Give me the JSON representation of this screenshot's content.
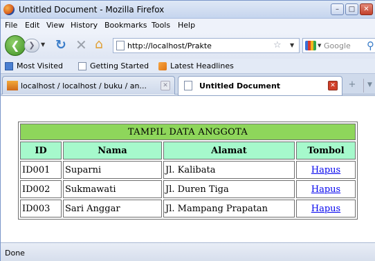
{
  "window": {
    "title": "Untitled Document - Mozilla Firefox",
    "buttons": {
      "minimize": "–",
      "maximize": "□",
      "close": "✕"
    }
  },
  "menu": [
    "File",
    "Edit",
    "View",
    "History",
    "Bookmarks",
    "Tools",
    "Help"
  ],
  "navigation": {
    "url": "http://localhost/Prakte",
    "search_placeholder": "Google"
  },
  "bookmarks": [
    "Most Visited",
    "Getting Started",
    "Latest Headlines"
  ],
  "tabs": [
    {
      "label": "localhost / localhost / buku / an...",
      "active": false,
      "icon": "phpmyadmin-icon"
    },
    {
      "label": "Untitled Document",
      "active": true,
      "icon": "page-icon"
    }
  ],
  "table": {
    "title": "TAMPIL DATA ANGGOTA",
    "headers": [
      "ID",
      "Nama",
      "Alamat",
      "Tombol"
    ],
    "rows": [
      {
        "id": "ID001",
        "nama": "Suparni",
        "alamat": "Jl. Kalibata",
        "tombol": "Hapus"
      },
      {
        "id": "ID002",
        "nama": "Sukmawati",
        "alamat": "Jl. Duren Tiga",
        "tombol": "Hapus"
      },
      {
        "id": "ID003",
        "nama": "Sari Anggar",
        "alamat": "Jl. Mampang Prapatan",
        "tombol": "Hapus"
      }
    ],
    "colors": {
      "title_bg": "#8ed65b",
      "header_bg": "#a6f9cc",
      "link": "#0000ee"
    }
  },
  "status": "Done"
}
